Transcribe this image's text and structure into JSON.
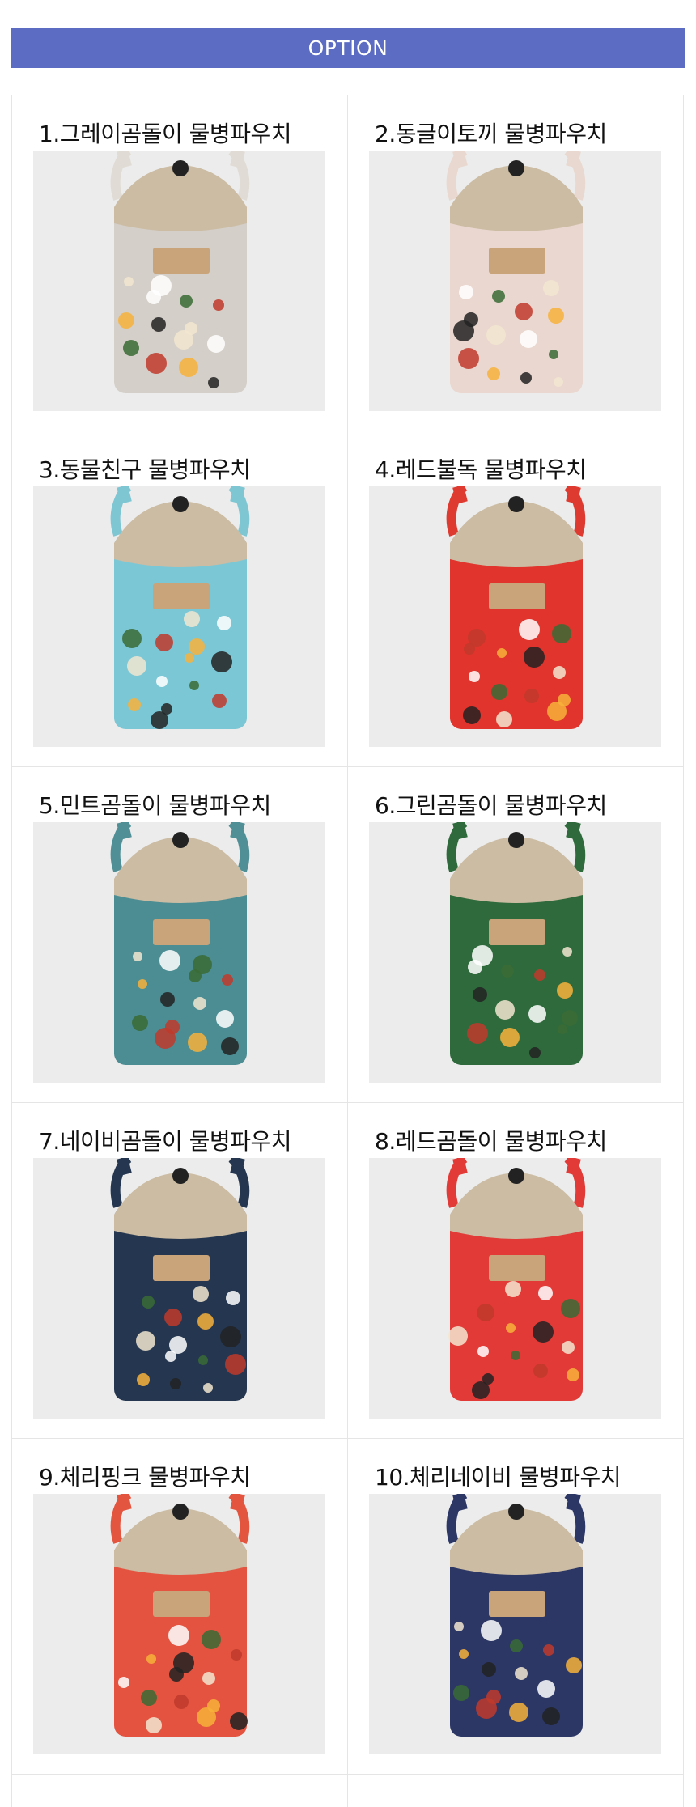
{
  "header": {
    "title": "OPTION",
    "color": "#5b6cc2"
  },
  "options": [
    {
      "label": "1.그레이곰돌이 물병파우치",
      "body_color": "#d4cfc8",
      "strap_color": "#e0dbd4",
      "print": "bears-grey"
    },
    {
      "label": "2.동글이토끼 물병파우치",
      "body_color": "#ead7cf",
      "strap_color": "#e9d8cf",
      "print": "rabbits"
    },
    {
      "label": "3.동물친구 물병파우치",
      "body_color": "#7cc7d6",
      "strap_color": "#7fc6d3",
      "print": "animals"
    },
    {
      "label": "4.레드불독 물병파우치",
      "body_color": "#e0342c",
      "strap_color": "#de3a30",
      "print": "bulldogs"
    },
    {
      "label": "5.민트곰돌이 물병파우치",
      "body_color": "#4c8d94",
      "strap_color": "#4f8f95",
      "print": "bears-mint"
    },
    {
      "label": "6.그린곰돌이 물병파우치",
      "body_color": "#2f6a3c",
      "strap_color": "#2f6a3c",
      "print": "bears-green"
    },
    {
      "label": "7.네이비곰돌이 물병파우치",
      "body_color": "#243650",
      "strap_color": "#243650",
      "print": "bears-navy"
    },
    {
      "label": "8.레드곰돌이 물병파우치",
      "body_color": "#e23a37",
      "strap_color": "#e23a37",
      "print": "bears-red"
    },
    {
      "label": "9.체리핑크 물병파우치",
      "body_color": "#e4533f",
      "strap_color": "#e4553f",
      "print": "cherry-pink"
    },
    {
      "label": "10.체리네이비 물병파우치",
      "body_color": "#2c3766",
      "strap_color": "#2c3766",
      "print": "cherry-navy"
    }
  ]
}
